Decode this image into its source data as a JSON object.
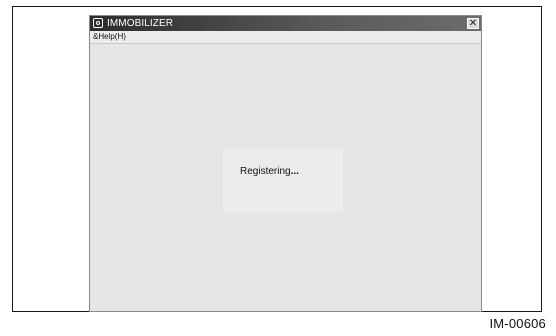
{
  "window": {
    "title": "IMMOBILIZER",
    "close_symbol": "✕"
  },
  "menu": {
    "items": [
      {
        "label": "&Help(H)"
      }
    ]
  },
  "status": {
    "text": "Registering",
    "ellipsis": "..."
  },
  "figure": {
    "caption": "IM-00606"
  },
  "icons": {
    "app": "app-icon",
    "close": "close-icon"
  },
  "colors": {
    "titlebar": "#3a3a3a",
    "window_bg": "#e6e6e6",
    "frame_border": "#1a1a1a"
  }
}
